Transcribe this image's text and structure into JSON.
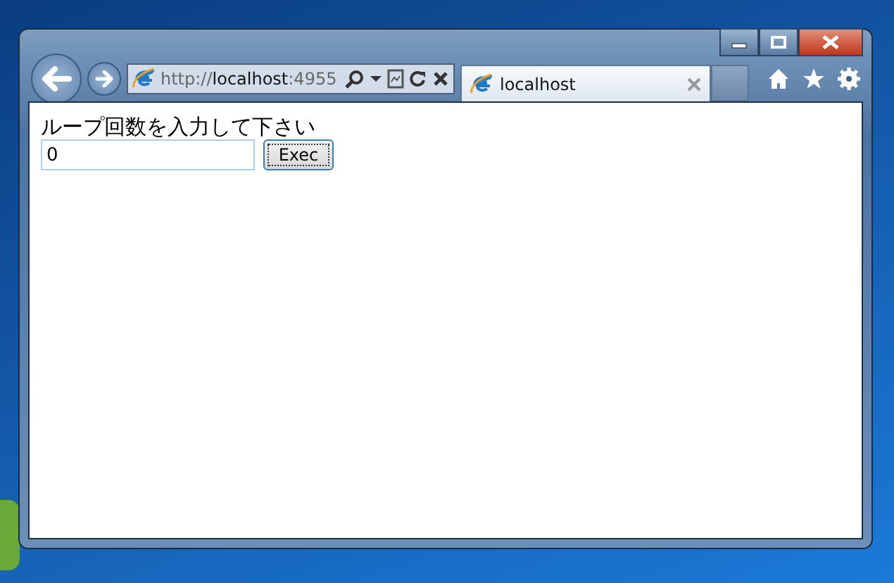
{
  "address_bar": {
    "scheme": "http://",
    "host": "localhost",
    "port": ":4955"
  },
  "tabs": [
    {
      "label": "localhost",
      "selected": true
    }
  ],
  "page": {
    "prompt": "ループ回数を入力して下さい",
    "input_value": "0",
    "button": "Exec"
  }
}
